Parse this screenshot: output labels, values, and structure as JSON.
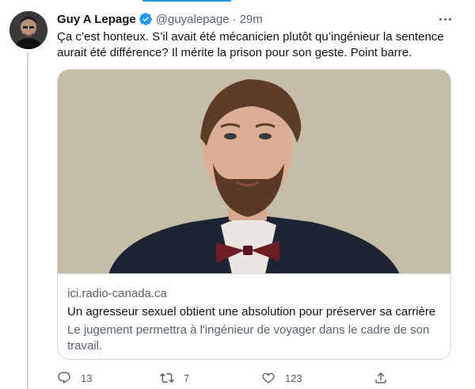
{
  "tweet": {
    "display_name": "Guy A Lepage",
    "handle": "@guyalepage",
    "separator": "·",
    "time": "29m",
    "text": "Ça c’est honteux. S’il avait été mécanicien plutôt qu’ingénieur la sentence aurait été différence? Il mérite la prison pour son geste. Point barre."
  },
  "card": {
    "domain": "ici.radio-canada.ca",
    "title": "Un agresseur sexuel obtient une absolution pour préserver sa carrière",
    "description": "Le jugement permettra à l'ingénieur de voyager dans le cadre de son travail."
  },
  "actions": {
    "reply_count": "13",
    "retweet_count": "7",
    "like_count": "123"
  },
  "colors": {
    "accent": "#1d9bf0",
    "text": "#0f1419",
    "secondary": "#536471",
    "border": "#cfd9de"
  },
  "icons": [
    "verified-badge-icon",
    "more-icon",
    "reply-icon",
    "retweet-icon",
    "like-icon",
    "share-icon"
  ]
}
